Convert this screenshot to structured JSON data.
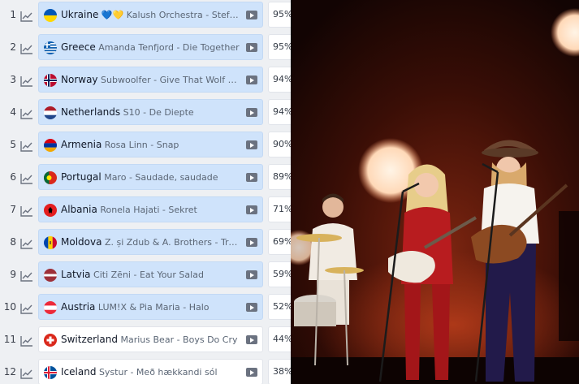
{
  "ranking": [
    {
      "rank": "1",
      "country": "Ukraine",
      "emoji": "💙💛",
      "artist_song": "Kalush Orchestra - Stefania",
      "score": "95%",
      "flag": "ukraine-flag-icon",
      "highlight": true
    },
    {
      "rank": "2",
      "country": "Greece",
      "emoji": "",
      "artist_song": "Amanda Tenfjord - Die Together",
      "score": "95%",
      "flag": "greece-flag-icon",
      "highlight": true
    },
    {
      "rank": "3",
      "country": "Norway",
      "emoji": "",
      "artist_song": "Subwoolfer - Give That Wolf a Banana",
      "score": "94%",
      "flag": "norway-flag-icon",
      "highlight": true
    },
    {
      "rank": "4",
      "country": "Netherlands",
      "emoji": "",
      "artist_song": "S10 - De Diepte",
      "score": "94%",
      "flag": "netherlands-flag-icon",
      "highlight": true
    },
    {
      "rank": "5",
      "country": "Armenia",
      "emoji": "",
      "artist_song": "Rosa Linn - Snap",
      "score": "90%",
      "flag": "armenia-flag-icon",
      "highlight": true
    },
    {
      "rank": "6",
      "country": "Portugal",
      "emoji": "",
      "artist_song": "Maro - Saudade, saudade",
      "score": "89%",
      "flag": "portugal-flag-icon",
      "highlight": true
    },
    {
      "rank": "7",
      "country": "Albania",
      "emoji": "",
      "artist_song": "Ronela Hajati - Sekret",
      "score": "71%",
      "flag": "albania-flag-icon",
      "highlight": true
    },
    {
      "rank": "8",
      "country": "Moldova",
      "emoji": "",
      "artist_song": "Z. și Zdub & A. Brothers - Trenulețul",
      "score": "69%",
      "flag": "moldova-flag-icon",
      "highlight": true
    },
    {
      "rank": "9",
      "country": "Latvia",
      "emoji": "",
      "artist_song": "Citi Zēni - Eat Your Salad",
      "score": "59%",
      "flag": "latvia-flag-icon",
      "highlight": true
    },
    {
      "rank": "10",
      "country": "Austria",
      "emoji": "",
      "artist_song": "LUM!X & Pia Maria - Halo",
      "score": "52%",
      "flag": "austria-flag-icon",
      "highlight": true
    },
    {
      "rank": "11",
      "country": "Switzerland",
      "emoji": "",
      "artist_song": "Marius Bear - Boys Do Cry",
      "score": "44%",
      "flag": "switzerland-flag-icon",
      "highlight": false
    },
    {
      "rank": "12",
      "country": "Iceland",
      "emoji": "",
      "artist_song": "Systur - Með hækkandi sól",
      "score": "38%",
      "flag": "iceland-flag-icon",
      "highlight": false
    }
  ],
  "icons": {
    "trend": "trend-chart-icon",
    "play": "video-play-icon"
  },
  "colors": {
    "highlight_card": "#cfe3fb",
    "plain_card": "#ffffff",
    "panel_bg": "#eef0f3",
    "stage_bg": "#1a0704"
  }
}
